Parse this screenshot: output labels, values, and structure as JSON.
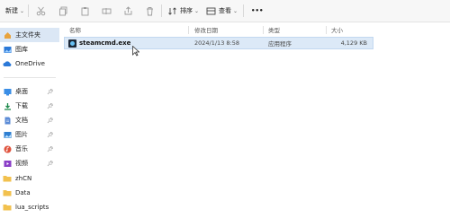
{
  "toolbar": {
    "new_label": "新建",
    "sort_label": "排序",
    "view_label": "查看",
    "more_label": "•••"
  },
  "sidebar": {
    "items": [
      {
        "label": "主文件夹",
        "icon": "home-icon",
        "pinned": false,
        "selected": true
      },
      {
        "label": "图库",
        "icon": "gallery-icon",
        "pinned": false
      },
      {
        "label": "OneDrive",
        "icon": "cloud-icon",
        "pinned": false
      },
      {
        "label": "桌面",
        "icon": "desktop-icon",
        "pinned": true
      },
      {
        "label": "下载",
        "icon": "download-icon",
        "pinned": true
      },
      {
        "label": "文档",
        "icon": "document-icon",
        "pinned": true
      },
      {
        "label": "图片",
        "icon": "picture-icon",
        "pinned": true
      },
      {
        "label": "音乐",
        "icon": "music-icon",
        "pinned": true
      },
      {
        "label": "视频",
        "icon": "video-icon",
        "pinned": true
      },
      {
        "label": "zhCN",
        "icon": "folder-icon",
        "pinned": false
      },
      {
        "label": "Data",
        "icon": "folder-icon",
        "pinned": false
      },
      {
        "label": "lua_scripts",
        "icon": "folder-icon",
        "pinned": false
      }
    ]
  },
  "columns": {
    "name": "名称",
    "date": "修改日期",
    "type": "类型",
    "size": "大小"
  },
  "files": [
    {
      "name": "steamcmd.exe",
      "date": "2024/1/13 8:58",
      "type": "应用程序",
      "size": "4,129 KB",
      "icon": "exe-icon"
    }
  ],
  "colors": {
    "selection": "#dce9f7",
    "sidebar_selected": "#dbe7f5",
    "accent": "#2b79d8"
  }
}
